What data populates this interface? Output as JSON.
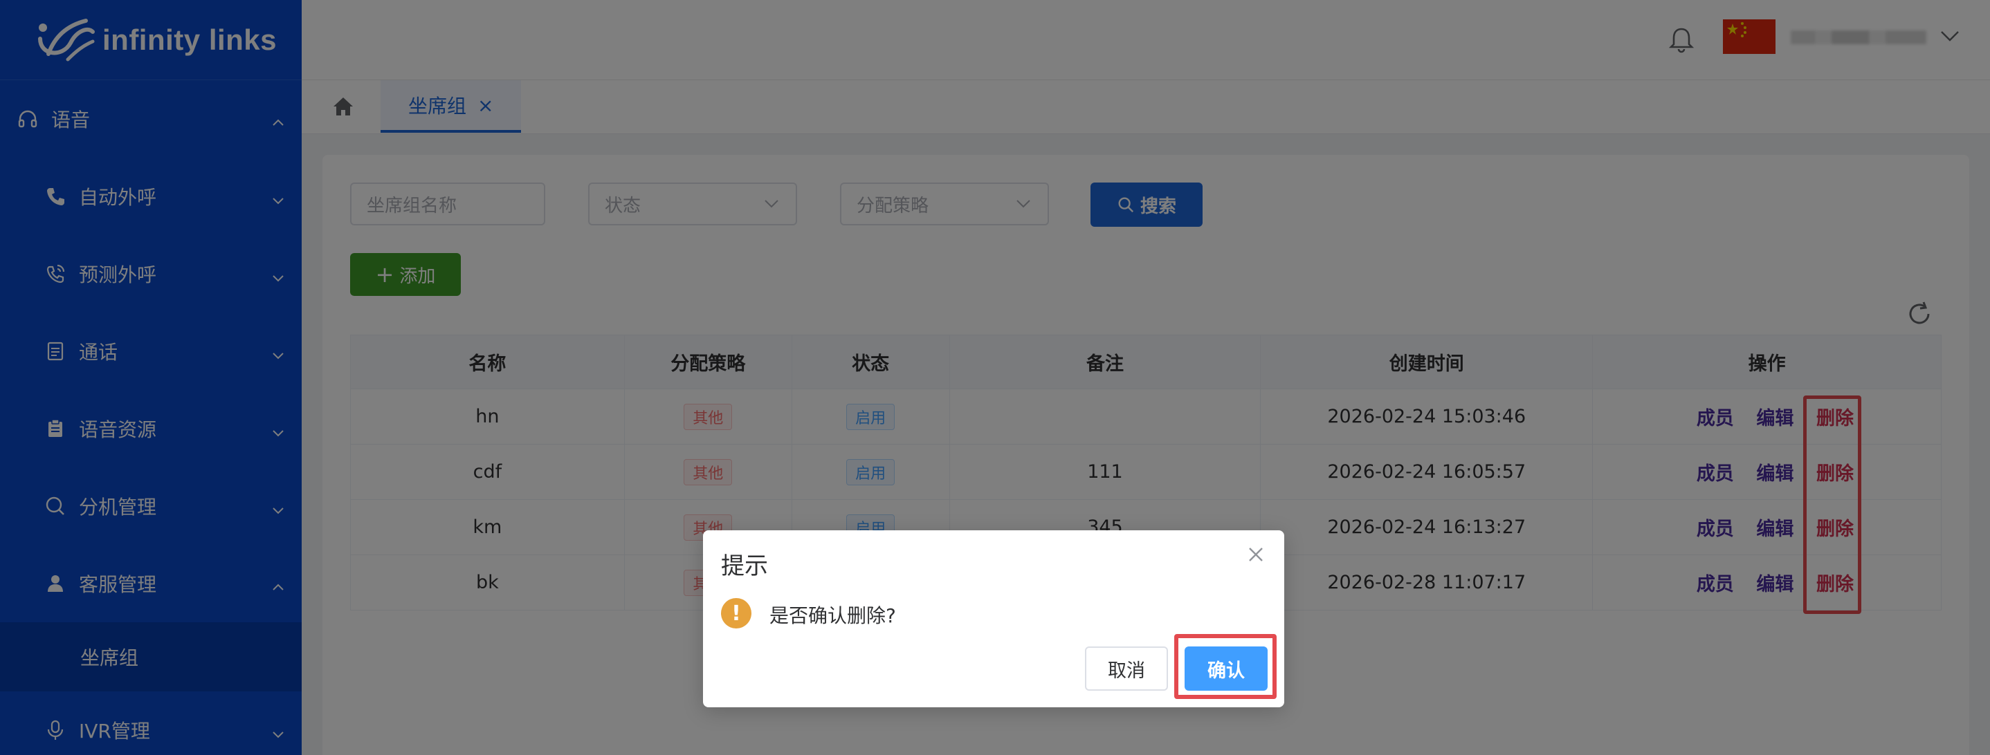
{
  "logo": {
    "text": "infinity links"
  },
  "sidebar": {
    "items": [
      {
        "label": "语音",
        "icon": "headset-icon",
        "expanded": true,
        "level": "top"
      },
      {
        "label": "自动外呼",
        "icon": "phone-icon",
        "expanded": false,
        "level": "sub"
      },
      {
        "label": "预测外呼",
        "icon": "phone-signal-icon",
        "expanded": false,
        "level": "sub"
      },
      {
        "label": "通话",
        "icon": "document-icon",
        "expanded": false,
        "level": "sub"
      },
      {
        "label": "语音资源",
        "icon": "clipboard-icon",
        "expanded": false,
        "level": "sub"
      },
      {
        "label": "分机管理",
        "icon": "search-icon",
        "expanded": false,
        "level": "sub"
      },
      {
        "label": "客服管理",
        "icon": "user-icon",
        "expanded": true,
        "level": "sub"
      }
    ],
    "active_leaf": "坐席组",
    "last_item": {
      "label": "IVR管理",
      "icon": "microphone-icon"
    }
  },
  "header": {
    "flag": "china-flag-icon",
    "user_name": ""
  },
  "tabs": {
    "active": "坐席组",
    "close": "×"
  },
  "filters": {
    "name_placeholder": "坐席组名称",
    "status_placeholder": "状态",
    "strategy_placeholder": "分配策略",
    "search_label": "搜索",
    "add_label": "添加"
  },
  "table": {
    "headers": [
      "名称",
      "分配策略",
      "状态",
      "备注",
      "创建时间",
      "操作"
    ],
    "rows": [
      {
        "name": "hn",
        "strategy": "其他",
        "status": "启用",
        "remark": "",
        "created": "2026-02-24 15:03:46"
      },
      {
        "name": "cdf",
        "strategy": "其他",
        "status": "启用",
        "remark": "111",
        "created": "2026-02-24 16:05:57"
      },
      {
        "name": "km",
        "strategy": "其他",
        "status": "启用",
        "remark": "345",
        "created": "2026-02-24 16:13:27"
      },
      {
        "name": "bk",
        "strategy": "其他",
        "status": "启用",
        "remark": "",
        "created": "2026-02-28 11:07:17"
      }
    ],
    "ops": {
      "member": "成员",
      "edit": "编辑",
      "delete": "删除"
    }
  },
  "dialog": {
    "title": "提示",
    "message": "是否确认删除?",
    "cancel": "取消",
    "confirm": "确认",
    "warn_glyph": "!"
  },
  "colors": {
    "sidebar": "#0a49c8",
    "primary": "#1f66d6",
    "success": "#3e9a28",
    "danger": "#e34a4f",
    "warning": "#e6a23c"
  }
}
